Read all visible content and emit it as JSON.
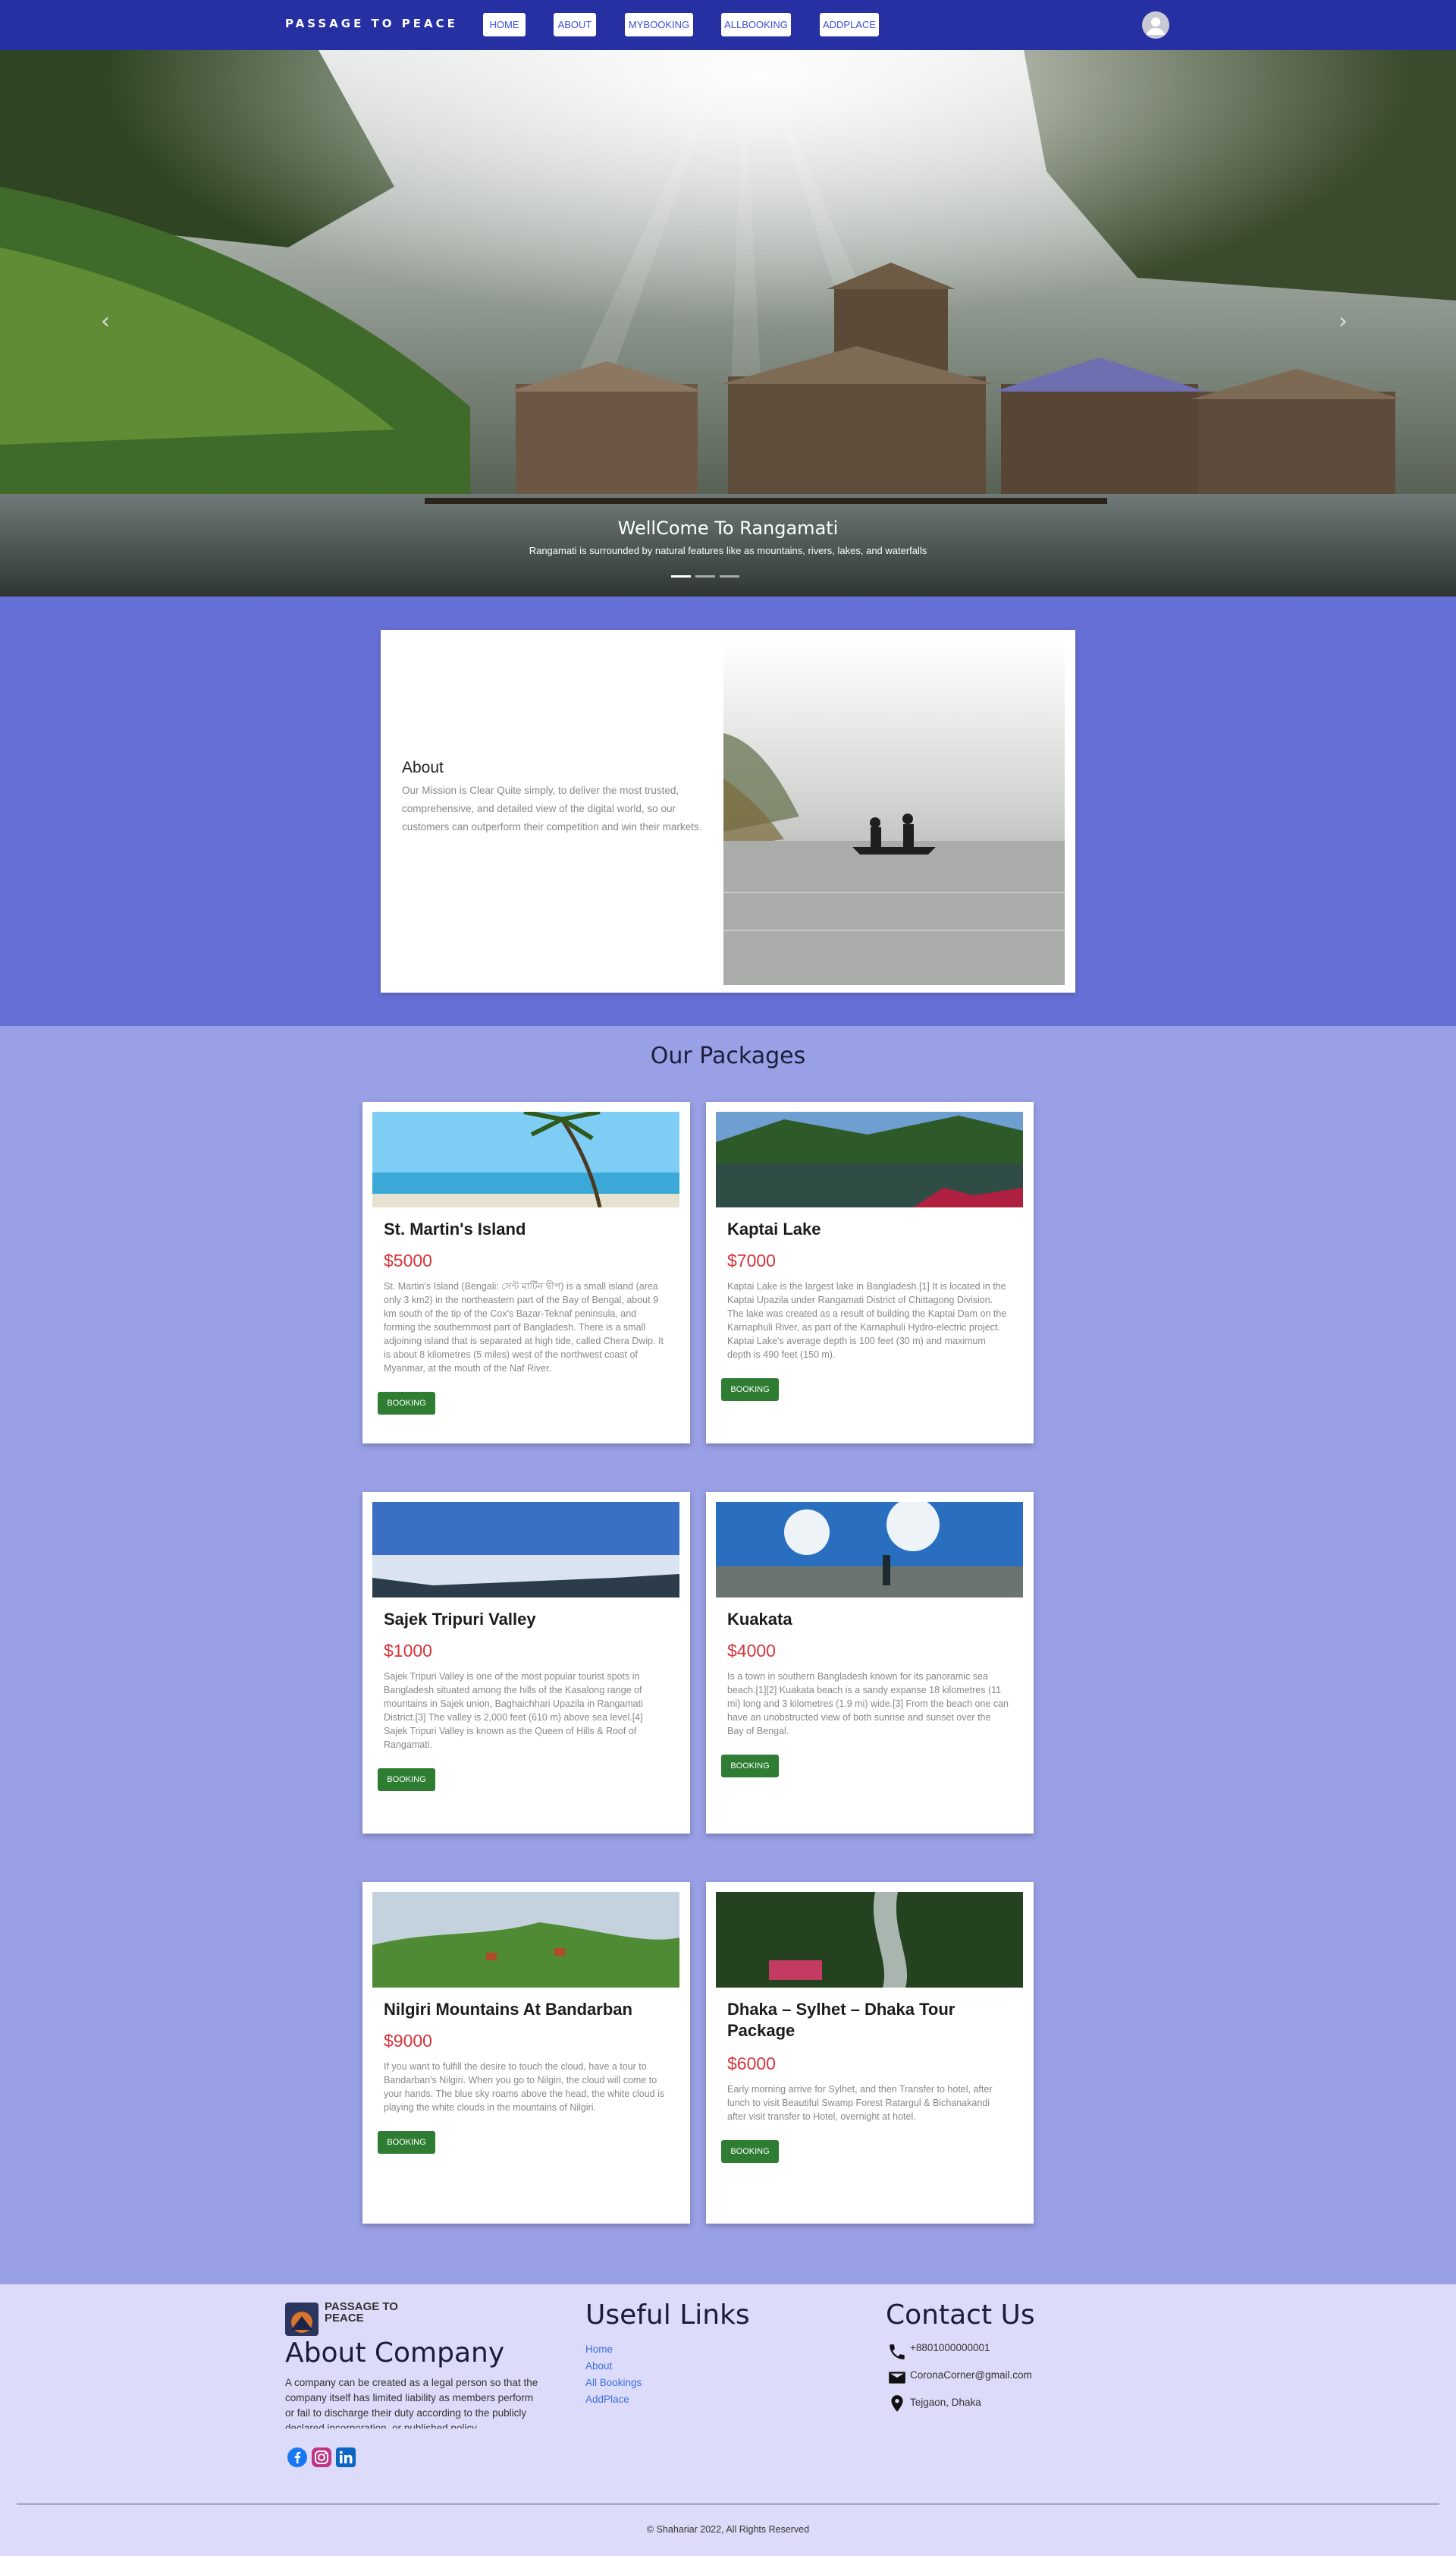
{
  "nav": {
    "brand": "PASSAGE TO PEACE",
    "links": [
      "HOME",
      "ABOUT",
      "MYBOOKING",
      "ALLBOOKING",
      "ADDPLACE"
    ]
  },
  "hero": {
    "title": "WellCome To Rangamati",
    "subtitle": "Rangamati is surrounded by natural features like as mountains, rivers, lakes, and waterfalls",
    "prev_icon": "chevron-left-icon",
    "next_icon": "chevron-right-icon",
    "slides": 3,
    "active_slide": 1
  },
  "about": {
    "heading": "About",
    "text": "Our Mission is Clear Quite simply, to deliver the most trusted, comprehensive, and detailed view of the digital world, so our customers can outperform their competition and win their markets."
  },
  "packages": {
    "title": "Our Packages",
    "button_label": "BOOKING",
    "items": [
      {
        "name": "St. Martin's Island",
        "price": "$5000",
        "desc": "St. Martin's Island (Bengali: সেন্ট মার্টিন দ্বীপ) is a small island (area only 3 km2) in the northeastern part of the Bay of Bengal, about 9 km south of the tip of the Cox's Bazar-Teknaf peninsula, and forming the southernmost part of Bangladesh. There is a small adjoining island that is separated at high tide, called Chera Dwip. It is about 8 kilometres (5 miles) west of the northwest coast of Myanmar, at the mouth of the Naf River."
      },
      {
        "name": "Kaptai Lake",
        "price": "$7000",
        "desc": "Kaptai Lake is the largest lake in Bangladesh.[1] It is located in the Kaptai Upazila under Rangamati District of Chittagong Division. The lake was created as a result of building the Kaptai Dam on the Karnaphuli River, as part of the Karnaphuli Hydro-electric project. Kaptai Lake's average depth is 100 feet (30 m) and maximum depth is 490 feet (150 m)."
      },
      {
        "name": "Sajek Tripuri Valley",
        "price": "$1000",
        "desc": "Sajek Tripuri Valley is one of the most popular tourist spots in Bangladesh situated among the hills of the Kasalong range of mountains in Sajek union, Baghaichhari Upazila in Rangamati District.[3] The valley is 2,000 feet (610 m) above sea level.[4] Sajek Tripuri Valley is known as the Queen of Hills & Roof of Rangamati."
      },
      {
        "name": "Kuakata",
        "price": "$4000",
        "desc": "Is a town in southern Bangladesh known for its panoramic sea beach.[1][2] Kuakata beach is a sandy expanse 18 kilometres (11 mi) long and 3 kilometres (1.9 mi) wide.[3] From the beach one can have an unobstructed view of both sunrise and sunset over the Bay of Bengal."
      },
      {
        "name": "Nilgiri Mountains At Bandarban",
        "price": "$9000",
        "desc": "If you want to fulfill the desire to touch the cloud, have a tour to Bandarban's Nilgiri. When you go to Nilgiri, the cloud will come to your hands. The blue sky roams above the head, the white cloud is playing the white clouds in the mountains of Nilgiri."
      },
      {
        "name": "Dhaka – Sylhet – Dhaka Tour Package",
        "price": "$6000",
        "desc": "Early morning arrive for Sylhet, and then Transfer to hotel, after lunch to visit Beautiful Swamp Forest Ratargul & Bichanakandi after visit transfer to Hotel, overnight at hotel."
      }
    ]
  },
  "footer": {
    "logo_text": "PASSAGE TO PEACE",
    "about_heading": "About Company",
    "about_text": "A company can be created as a legal person so that the company itself has limited liability as members perform or fail to discharge their duty according to the publicly declared incorporation, or published policy.",
    "links_heading": "Useful Links",
    "links": [
      "Home",
      "About",
      "All Bookings",
      "AddPlace"
    ],
    "contact_heading": "Contact Us",
    "phone": "+8801000000001",
    "email": "CoronaCorner@gmail.com",
    "address": "Tejgaon, Dhaka",
    "social_icons": [
      "facebook-icon",
      "instagram-icon",
      "linkedin-icon"
    ],
    "copyright": "© Shahariar 2022, All Rights Reserved"
  },
  "colors": {
    "nav_bg": "#2630a2",
    "about_bg": "#6770d6",
    "packages_bg": "#9aa0e6",
    "footer_bg": "#dcdcfa",
    "price": "#d6343a",
    "booking_button": "#2e7d32"
  }
}
